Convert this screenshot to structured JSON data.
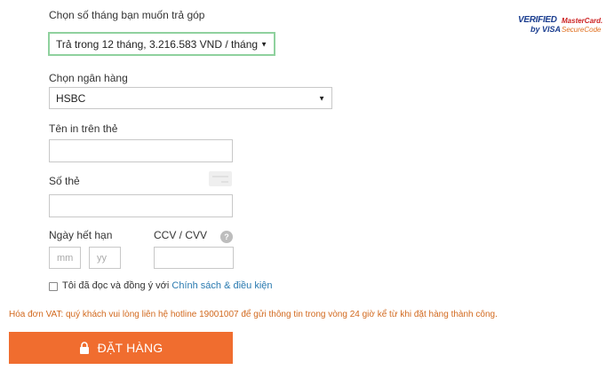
{
  "installment": {
    "label": "Chọn số tháng bạn muốn trả góp",
    "selected": "Trả trong 12 tháng, 3.216.583 VND / tháng",
    "accent_border": "#8fd19e"
  },
  "bank": {
    "label": "Chọn ngân hàng",
    "selected": "HSBC"
  },
  "card_name": {
    "label": "Tên in trên thẻ",
    "value": ""
  },
  "card_number": {
    "label": "Số thẻ",
    "value": ""
  },
  "expiry": {
    "label": "Ngày hết hạn",
    "month_placeholder": "mm",
    "year_placeholder": "yy"
  },
  "cvv": {
    "label": "CCV / CVV",
    "help": "?"
  },
  "agree": {
    "text": "Tôi đã đọc và đồng ý với ",
    "link": "Chính sách & điều kiện",
    "checked": false
  },
  "vat_note": "Hóa đơn VAT: quý khách vui lòng liên hệ hotline 19001007 để gửi thông tin trong vòng 24 giờ kể từ khi đặt hàng thành công.",
  "order_button": {
    "label": "ĐẶT HÀNG",
    "color": "#f06d2f",
    "icon": "lock-icon"
  },
  "badges": {
    "visa_line1": "VERIFIED",
    "visa_line2": "by VISA",
    "mc_line1": "MasterCard.",
    "mc_line2": "SecureCode"
  },
  "colors": {
    "text": "#333333",
    "link": "#2a7ab0",
    "vat": "#d2691e",
    "visa_blue": "#1a3d8f",
    "mc_red": "#cc2222"
  }
}
